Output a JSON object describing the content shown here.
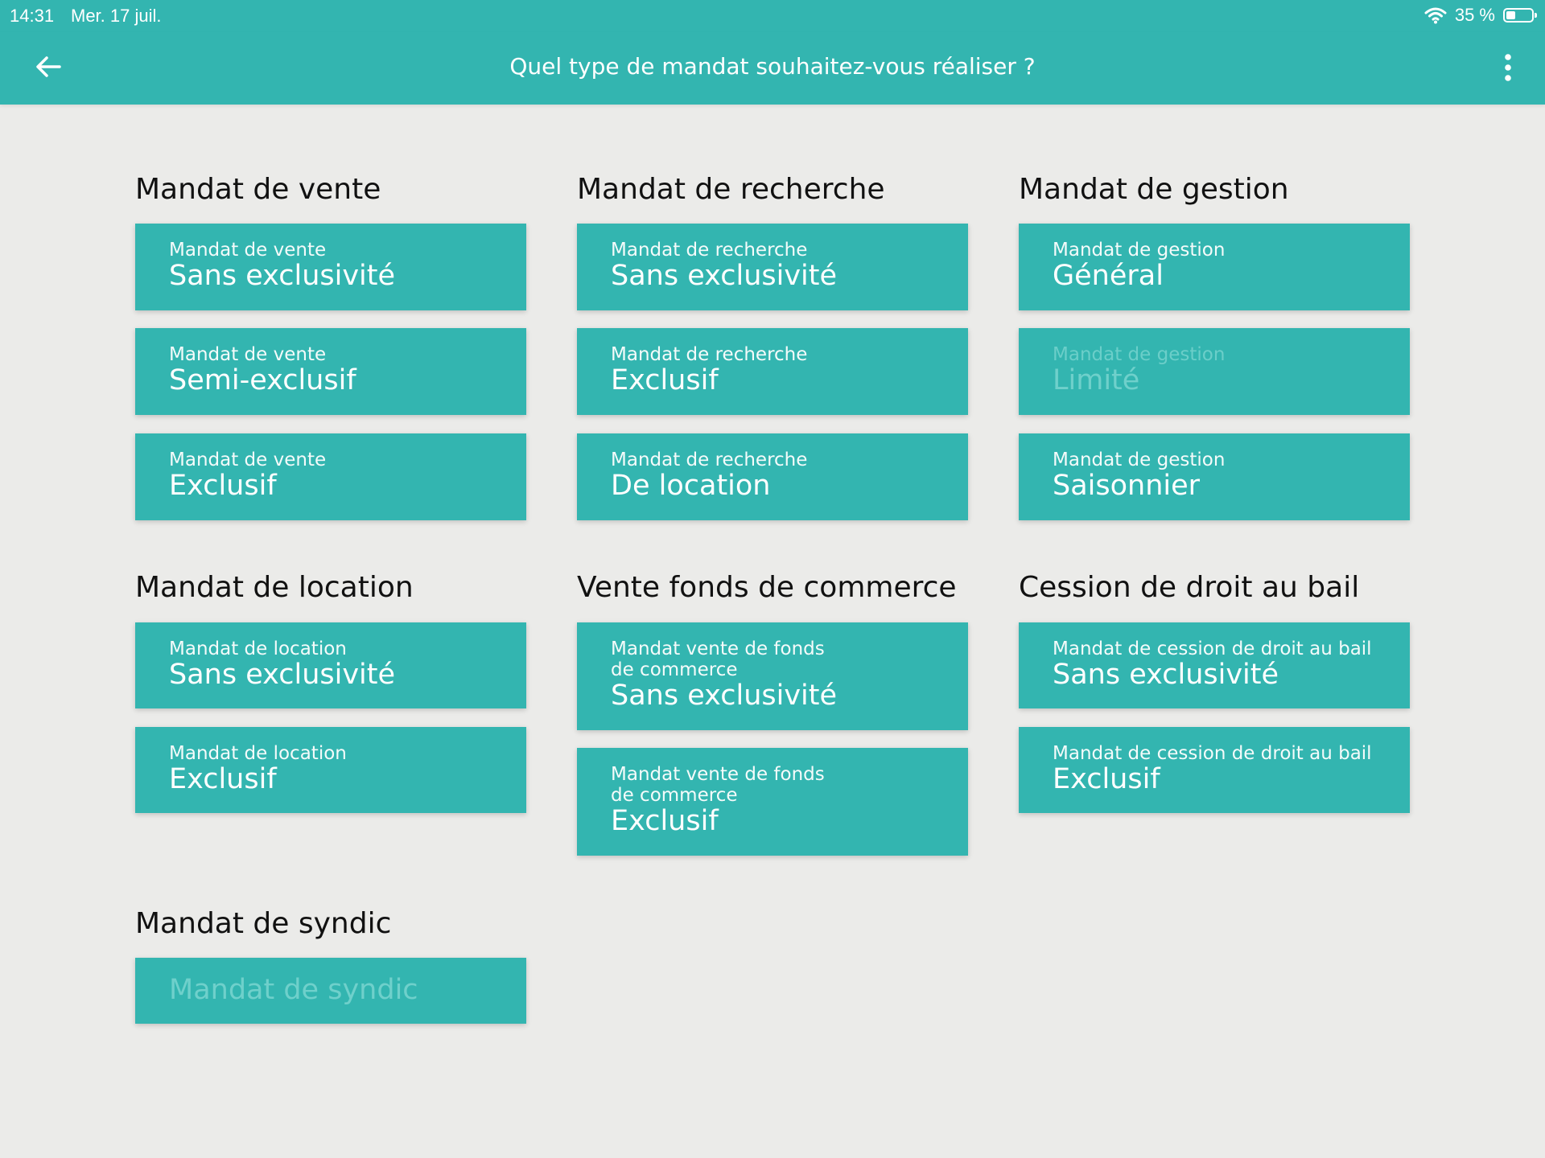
{
  "status_bar": {
    "time": "14:31",
    "date": "Mer. 17 juil.",
    "battery_text": "35 %",
    "battery_level": 0.35
  },
  "nav": {
    "title": "Quel type de mandat souhaitez-vous réaliser ?",
    "back_icon": "arrow-left-icon",
    "menu_icon": "more-vertical-icon"
  },
  "colors": {
    "accent": "#33b5b0",
    "background": "#ebebe9",
    "disabled_text": "#6fd0cb"
  },
  "sections": {
    "vente": {
      "title": "Mandat de vente",
      "cards": [
        {
          "sub": "Mandat de vente",
          "main": "Sans exclusivité"
        },
        {
          "sub": "Mandat de vente",
          "main": "Semi-exclusif"
        },
        {
          "sub": "Mandat de vente",
          "main": "Exclusif"
        }
      ]
    },
    "recherche": {
      "title": "Mandat de recherche",
      "cards": [
        {
          "sub": "Mandat de recherche",
          "main": "Sans exclusivité"
        },
        {
          "sub": "Mandat de recherche",
          "main": "Exclusif"
        },
        {
          "sub": "Mandat de recherche",
          "main": "De location"
        }
      ]
    },
    "gestion": {
      "title": "Mandat de gestion",
      "cards": [
        {
          "sub": "Mandat de gestion",
          "main": "Général"
        },
        {
          "sub": "Mandat de gestion",
          "main": "Limité",
          "disabled": true
        },
        {
          "sub": "Mandat de gestion",
          "main": "Saisonnier"
        }
      ]
    },
    "location": {
      "title": "Mandat de location",
      "cards": [
        {
          "sub": "Mandat de location",
          "main": "Sans exclusivité"
        },
        {
          "sub": "Mandat de location",
          "main": "Exclusif"
        }
      ]
    },
    "fonds": {
      "title": "Vente fonds de commerce",
      "cards": [
        {
          "sub": "Mandat vente de fonds\nde commerce",
          "main": "Sans exclusivité"
        },
        {
          "sub": "Mandat vente de fonds\nde commerce",
          "main": "Exclusif"
        }
      ]
    },
    "bail": {
      "title": "Cession de droit au bail",
      "cards": [
        {
          "sub": "Mandat de cession de droit au bail",
          "main": "Sans exclusivité"
        },
        {
          "sub": "Mandat de cession de droit au bail",
          "main": "Exclusif"
        }
      ]
    },
    "syndic": {
      "title": "Mandat de syndic",
      "cards": [
        {
          "main": "Mandat de syndic",
          "disabled": true
        }
      ]
    }
  }
}
